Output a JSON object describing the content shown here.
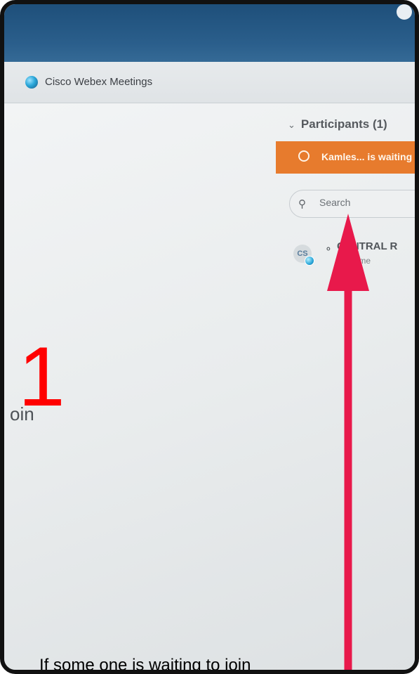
{
  "app": {
    "title": "Cisco Webex Meetings"
  },
  "participants_panel": {
    "header": "Participants (1)",
    "chevron_icon": "chevron-down-icon",
    "banner": {
      "icon": "waiting-icon",
      "text": "Kamles... is waiting",
      "color": "#e77b2d"
    },
    "search": {
      "placeholder": "Search"
    },
    "participant": {
      "initials": "CS",
      "name": "CENTRAL R",
      "role": "Host, me"
    }
  },
  "main": {
    "partial_text": "oin"
  },
  "annotation": {
    "step_number": "1",
    "caption": "If some one is waiting to join",
    "arrow_color": "#e8194b",
    "number_color": "#ff0000"
  }
}
